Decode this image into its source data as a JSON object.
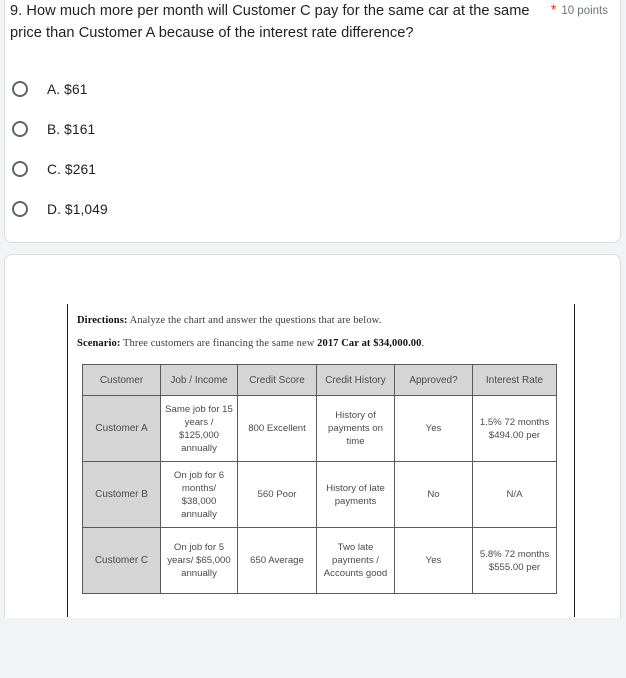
{
  "question": {
    "number": "9.",
    "text": "How much more per month will Customer C pay for the same car at the same price than Customer A because of the interest rate difference?",
    "full_text": "9.  How much more per month will Customer C pay for the same car at the same price than Customer A because of the interest rate difference?",
    "required_marker": "*",
    "points": "10 points",
    "options": [
      {
        "label": "A. $61"
      },
      {
        "label": "B. $161"
      },
      {
        "label": "C. $261"
      },
      {
        "label": "D. $1,049"
      }
    ]
  },
  "attachment": {
    "directions_label": "Directions:",
    "directions_text": " Analyze the chart and answer the questions that are below.",
    "scenario_label": "Scenario:",
    "scenario_text_before": " Three customers are financing the same new ",
    "scenario_bold": "2017 Car at $34,000.00",
    "scenario_text_after": ".",
    "chart_data": {
      "type": "table",
      "title": "Three customers financing the same new 2017 Car at $34,000.00",
      "columns": [
        "Customer",
        "Job / Income",
        "Credit Score",
        "Credit History",
        "Approved?",
        "Interest Rate"
      ],
      "rows": [
        {
          "customer": "Customer A",
          "job_income": "Same job for 15 years / $125,000 annually",
          "credit_score": "800 Excellent",
          "credit_history": "History of payments on time",
          "approved": "Yes",
          "interest_rate": "1.5% 72 months $494.00 per"
        },
        {
          "customer": "Customer B",
          "job_income": "On job for 6 months/ $38,000 annually",
          "credit_score": "560 Poor",
          "credit_history": "History of late payments",
          "approved": "No",
          "interest_rate": "N/A"
        },
        {
          "customer": "Customer C",
          "job_income": "On job for 5 years/ $65,000 annually",
          "credit_score": "650 Average",
          "credit_history": "Two late payments / Accounts good",
          "approved": "Yes",
          "interest_rate": "5.8% 72 months $555.00 per"
        }
      ]
    }
  },
  "colors": {
    "page_background": "#f1f3f4",
    "card_background": "#ffffff",
    "card_border": "#dadce0",
    "required_star": "#d93025",
    "text_primary": "#202124",
    "text_secondary": "#70757a",
    "table_header_fill": "#d5d5d5",
    "table_border": "#5a5a5a"
  }
}
